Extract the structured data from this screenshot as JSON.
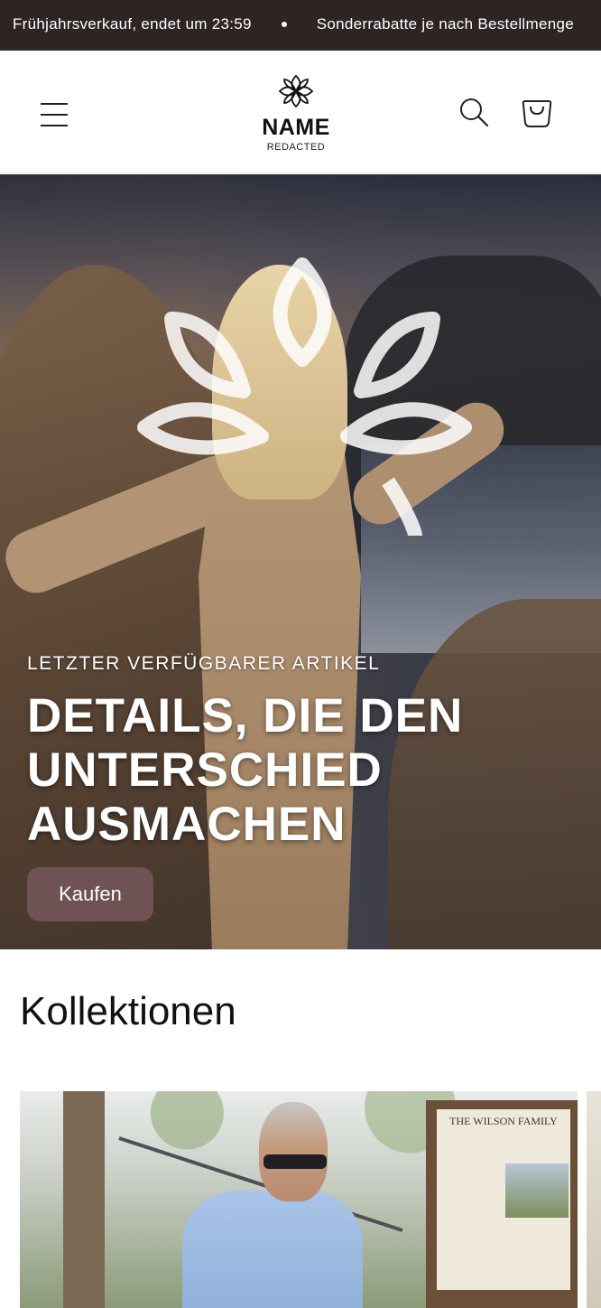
{
  "announcement": {
    "items": [
      "Frühjahrsverkauf, endet um 23:59",
      "Sonderrabatte je nach Bestellmenge"
    ]
  },
  "header": {
    "brand_name": "NAME",
    "brand_sub": "REDACTED",
    "icons": [
      "menu-icon",
      "search-icon",
      "cart-icon"
    ]
  },
  "hero": {
    "eyebrow": "LETZTER VERFÜGBARER ARTIKEL",
    "title": "DETAILS, DIE DEN UNTERSCHIED AUSMACHEN",
    "button_label": "Kaufen",
    "button_color": "#6f5254"
  },
  "collections": {
    "title": "Kollektionen",
    "card_sign_text": "THE WILSON FAMILY"
  },
  "colors": {
    "announcement_bg": "#2e2424",
    "accent": "#6f5254"
  }
}
